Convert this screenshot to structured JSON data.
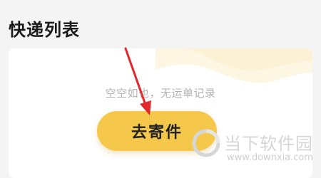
{
  "header": {
    "title": "快递列表"
  },
  "empty_state": {
    "message": "空空如也，无运单记录",
    "action_label": "去寄件"
  },
  "watermark": {
    "name": "当下软件园",
    "url": "www.downxia.com"
  },
  "colors": {
    "button_bg": "#f5c84c",
    "arrow": "#e0282e",
    "title_text": "#1a1a1a",
    "empty_text": "#b3b3b3"
  },
  "icons": {
    "arrow": "red-arrow-annotation",
    "watermark_logo": "downxia-logo-icon"
  }
}
